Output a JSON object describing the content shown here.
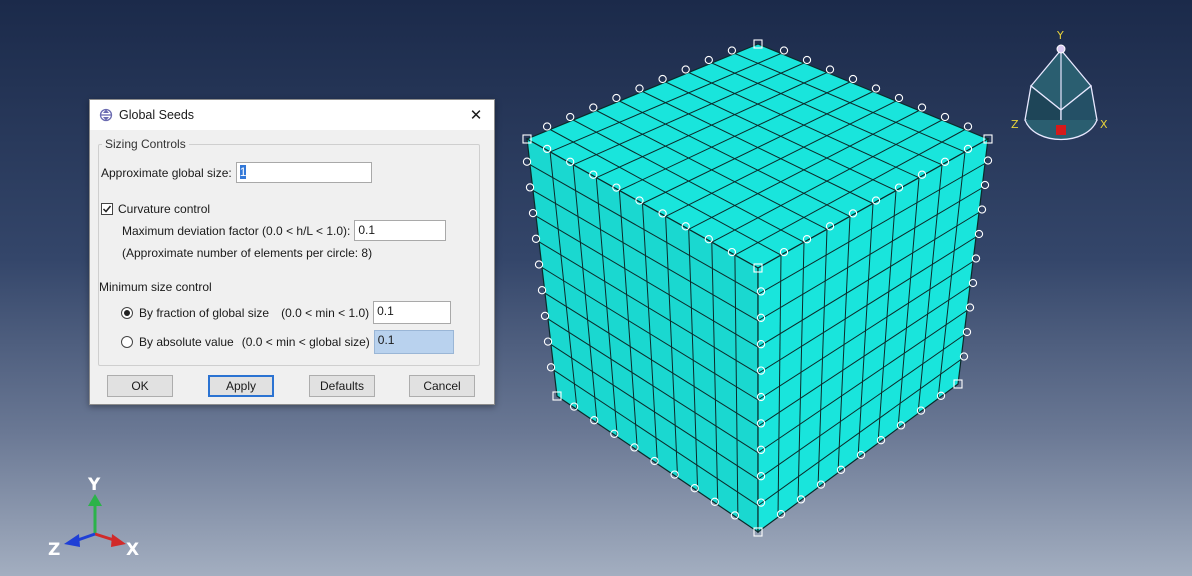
{
  "dialog": {
    "title": "Global Seeds",
    "close_label": "✕",
    "sizing_section_label": "Sizing Controls",
    "approx_size_label": "Approximate global size:",
    "approx_size_value": "1",
    "curvature_label": "Curvature control",
    "curvature_checked": true,
    "max_dev_label": "Maximum deviation factor (0.0 < h/L < 1.0):",
    "max_dev_value": "0.1",
    "approx_elements_note": "(Approximate number of elements per circle: 8)",
    "min_size_section_label": "Minimum size control",
    "fraction_label": "By fraction of global size",
    "fraction_range": "(0.0 < min < 1.0)",
    "fraction_value": "0.1",
    "fraction_selected": true,
    "absolute_label": "By absolute value",
    "absolute_range": "(0.0 < min < global size)",
    "absolute_value": "0.1",
    "buttons": {
      "ok": "OK",
      "apply": "Apply",
      "defaults": "Defaults",
      "cancel": "Cancel"
    }
  },
  "triad_small": {
    "y": "Y",
    "z": "Z",
    "x": "X"
  },
  "triad_main": {
    "y": "Y",
    "z": "Z",
    "x": "X"
  },
  "colors": {
    "mesh_face": "#19e5dc",
    "mesh_face_side": "#1ad8d0",
    "accent": "#2b73d2",
    "axis_x": "#d12a2a",
    "axis_y": "#2bb34a",
    "axis_z": "#1f3fd6",
    "triad_label": "#e8d23a"
  },
  "mesh": {
    "divisions": 10
  }
}
